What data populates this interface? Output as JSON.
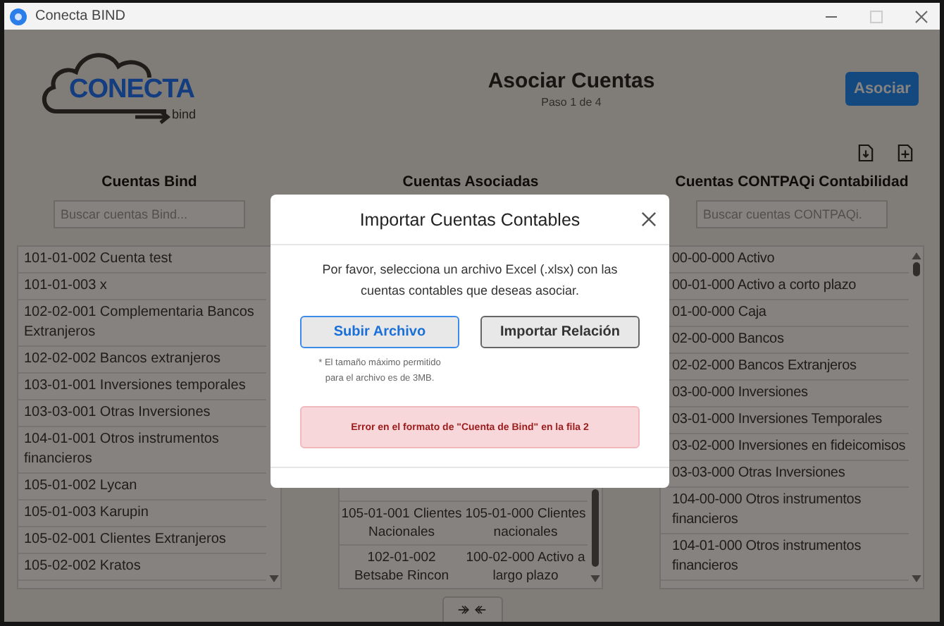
{
  "window": {
    "title": "Conecta BIND"
  },
  "logo": {
    "name": "CONECTA",
    "sub": "bind"
  },
  "header": {
    "title": "Asociar Cuentas",
    "step": "Paso 1 de 4",
    "action": "Asociar"
  },
  "bind_panel": {
    "heading": "Cuentas Bind",
    "placeholder": "Buscar cuentas Bind...",
    "items": [
      "101-01-002 Cuenta test",
      "101-01-003 x",
      "102-02-001 Complementaria Bancos Extranjeros",
      "102-02-002 Bancos extranjeros",
      "103-01-001 Inversiones temporales",
      "103-03-001 Otras Inversiones",
      "104-01-001 Otros instrumentos financieros",
      "105-01-002 Lycan",
      "105-01-003 Karupin",
      "105-02-001 Clientes Extranjeros",
      "105-02-002 Kratos"
    ]
  },
  "associated_panel": {
    "heading": "Cuentas Asociadas",
    "pairs": [
      {
        "bind": "105-01-001 Clientes Nacionales",
        "contpaqi": "105-01-000 Clientes nacionales"
      },
      {
        "bind": "102-01-002 Betsabe Rincon",
        "contpaqi": "100-02-000 Activo a largo plazo"
      }
    ]
  },
  "contpaqi_panel": {
    "heading": "Cuentas CONTPAQi Contabilidad",
    "placeholder": "Buscar cuentas CONTPAQi.",
    "items": [
      "00-00-000 Activo",
      "00-01-000 Activo a corto plazo",
      "01-00-000 Caja",
      "02-00-000 Bancos",
      "02-02-000 Bancos Extranjeros",
      "03-00-000 Inversiones",
      "03-01-000 Inversiones Temporales",
      "03-02-000 Inversiones en fideicomisos",
      "03-03-000 Otras Inversiones",
      "104-00-000 Otros instrumentos financieros",
      "104-01-000 Otros instrumentos financieros"
    ]
  },
  "modal": {
    "title": "Importar Cuentas Contables",
    "message": "Por favor, selecciona un archivo Excel (.xlsx) con las cuentas contables que deseas asociar.",
    "buttons": [
      {
        "label": "Subir Archivo",
        "kind": "primary"
      },
      {
        "label": "Importar Relación",
        "kind": "secondary"
      }
    ],
    "note": "* El tamaño máximo permitido para el archivo es de 3MB.",
    "error": "Error en el formato de \"Cuenta de Bind\" en la fila 2"
  }
}
